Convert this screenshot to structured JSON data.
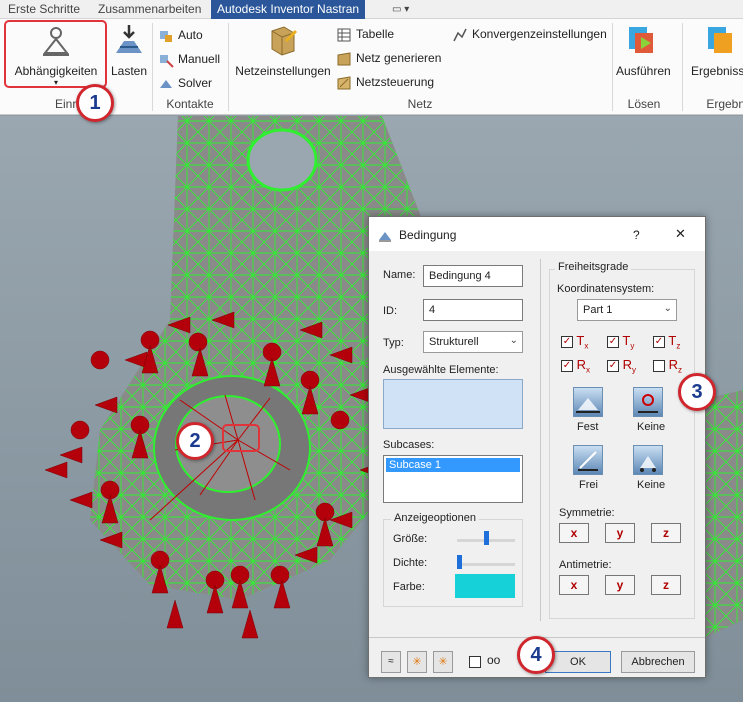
{
  "ribbon_tabs": [
    "Erste Schritte",
    "Zusammenarbeiten",
    "Autodesk Inventor Nastran"
  ],
  "ribbon": {
    "abhaengigkeiten": "Abhängigkeiten",
    "lasten": "Lasten",
    "auto": "Auto",
    "manuell": "Manuell",
    "solver": "Solver",
    "netzeinstellungen": "Netzeinstellungen",
    "tabelle": "Tabelle",
    "netz_generieren": "Netz generieren",
    "netzsteuerung": "Netzsteuerung",
    "konvergenz": "Konvergenzeinstellungen",
    "ausfuehren": "Ausführen",
    "ergebnisse": "Ergebnisse",
    "group_einr": "Einric",
    "group_kontakte": "Kontakte",
    "group_netz": "Netz",
    "group_loesen": "Lösen",
    "group_ergebnis": "Ergebnis"
  },
  "dialog": {
    "title": "Bedingung",
    "help": "?",
    "close": "✕",
    "name_label": "Name:",
    "name_value": "Bedingung 4",
    "id_label": "ID:",
    "id_value": "4",
    "typ_label": "Typ:",
    "typ_value": "Strukturell",
    "elements_label": "Ausgewählte Elemente:",
    "subcases_label": "Subcases:",
    "subcase_item": "Subcase 1",
    "display_group": "Anzeigeoptionen",
    "groesse": "Größe:",
    "dichte": "Dichte:",
    "farbe": "Farbe:",
    "farbe_color": "#17d1d9",
    "dof_group": "Freiheitsgrade",
    "koord_label": "Koordinatensystem:",
    "koord_value": "Part 1",
    "dof": [
      {
        "base": "T",
        "sub": "x",
        "checked": true
      },
      {
        "base": "T",
        "sub": "y",
        "checked": true
      },
      {
        "base": "T",
        "sub": "z",
        "checked": true
      },
      {
        "base": "R",
        "sub": "x",
        "checked": true
      },
      {
        "base": "R",
        "sub": "y",
        "checked": true
      },
      {
        "base": "R",
        "sub": "z",
        "checked": false
      }
    ],
    "fest": "Fest",
    "keine1": "Keine",
    "frei": "Frei",
    "keine2": "Keine",
    "symmetrie": "Symmetrie:",
    "antimetrie": "Antimetrie:",
    "x": "x",
    "y": "y",
    "z": "z",
    "ok": "OK",
    "abbrechen": "Abbrechen"
  },
  "callouts": [
    "1",
    "2",
    "3",
    "4"
  ],
  "colors": {
    "accent": "#2b579a",
    "mesh": "#2ef02e",
    "arrow": "#b3000a",
    "callout": "#d0272e"
  }
}
